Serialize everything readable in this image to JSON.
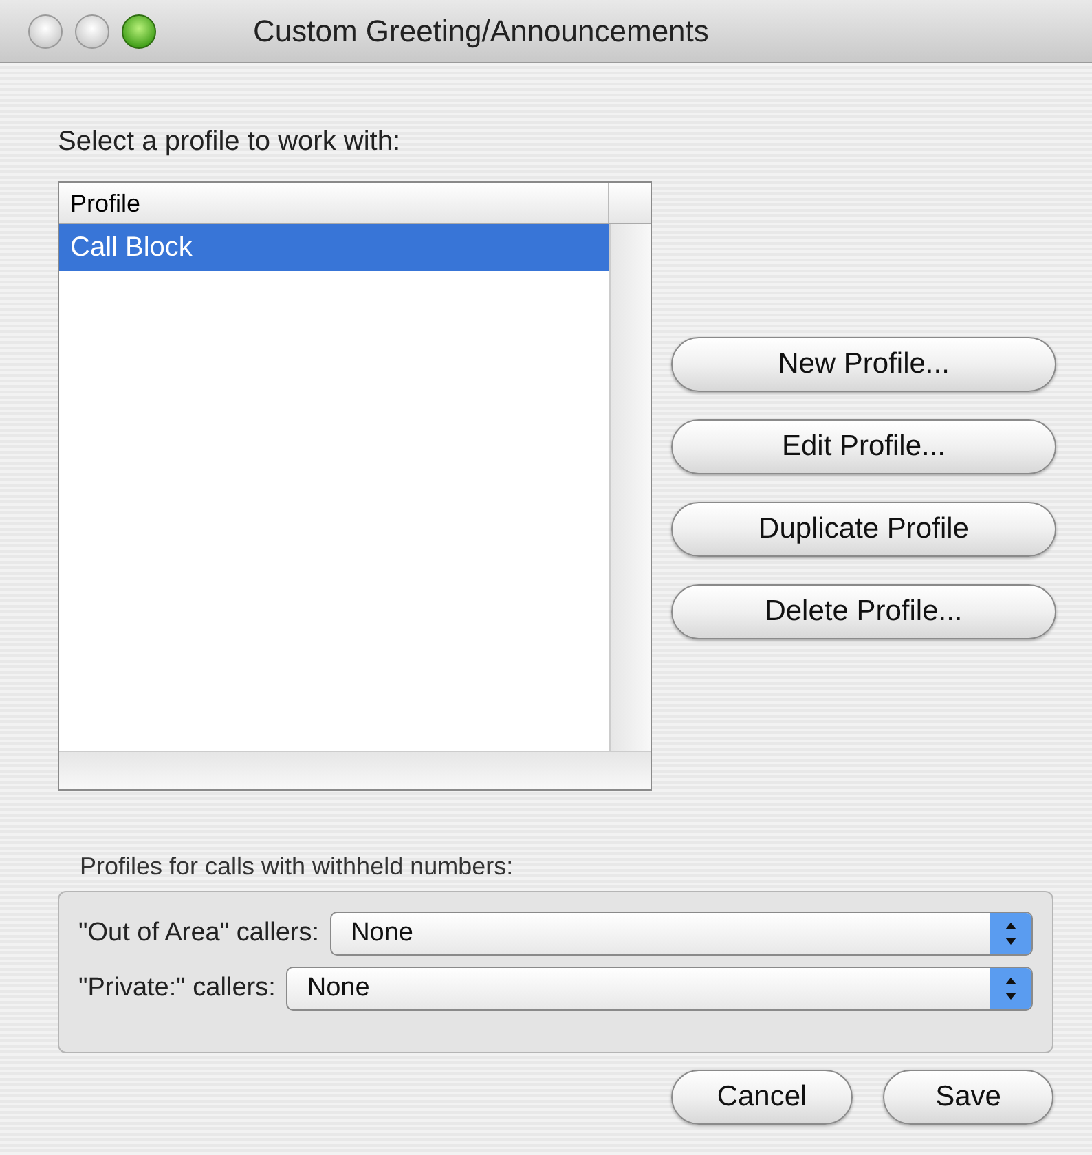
{
  "window": {
    "title": "Custom Greeting/Announcements"
  },
  "prompt": "Select a profile to work with:",
  "table": {
    "columns": [
      "Profile"
    ],
    "rows": [
      {
        "cells": [
          "Call Block"
        ],
        "selected": true
      }
    ]
  },
  "profile_buttons": [
    "New Profile...",
    "Edit Profile...",
    "Duplicate Profile",
    "Delete Profile..."
  ],
  "withheld": {
    "label": "Profiles for calls with withheld numbers:",
    "selects": [
      {
        "label": "\"Out of Area\" callers:",
        "value": "None"
      },
      {
        "label": "\"Private:\" callers:",
        "value": "None"
      }
    ]
  },
  "footer_buttons": [
    "Cancel",
    "Save"
  ]
}
